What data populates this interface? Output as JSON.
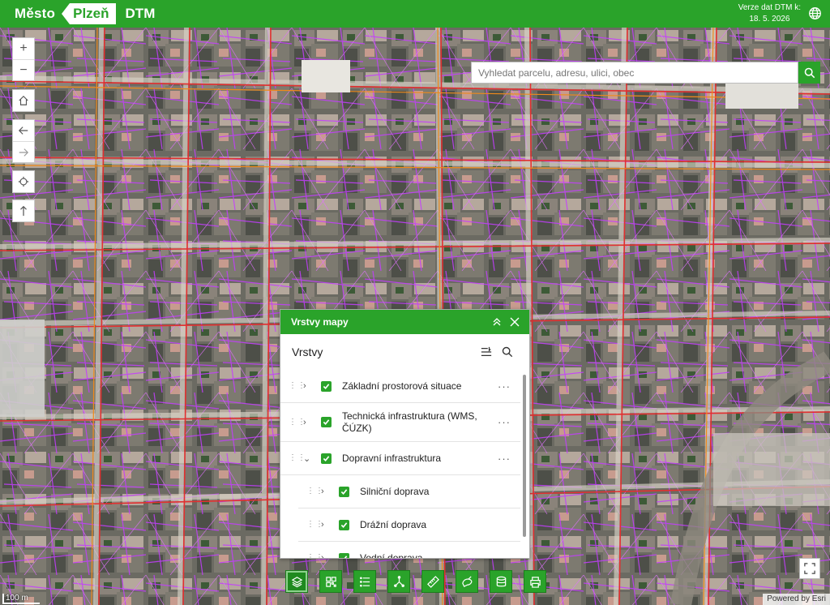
{
  "header": {
    "logo_mesto": "Město",
    "logo_plzen": "Plzeň",
    "app_name": "DTM",
    "version_label": "Verze dat DTM k:",
    "version_date": "18. 5. 2026",
    "brand_color": "#2aa32a"
  },
  "map_controls": {
    "zoom_in": "+",
    "zoom_out": "−"
  },
  "search": {
    "placeholder": "Vyhledat parcelu, adresu, ulici, obec"
  },
  "layers_panel": {
    "title": "Vrstvy mapy",
    "subtitle": "Vrstvy",
    "items": [
      {
        "label": "Základní prostorová situace",
        "expanded": false,
        "checked": true,
        "child": false
      },
      {
        "label": "Technická infrastruktura (WMS, ČÚZK)",
        "expanded": false,
        "checked": true,
        "child": false
      },
      {
        "label": "Dopravní infrastruktura",
        "expanded": true,
        "checked": true,
        "child": false
      },
      {
        "label": "Silniční doprava",
        "expanded": false,
        "checked": true,
        "child": true
      },
      {
        "label": "Drážní doprava",
        "expanded": false,
        "checked": true,
        "child": true
      },
      {
        "label": "Vodní doprava",
        "expanded": false,
        "checked": true,
        "child": true
      }
    ]
  },
  "toolbar": {
    "buttons": [
      "layers-icon",
      "qr-grid-icon",
      "legend-list-icon",
      "measure-icon",
      "ruler-icon",
      "edit-draw-icon",
      "database-icon",
      "print-icon"
    ]
  },
  "scale_label": "100 m",
  "attribution": "Powered by Esri"
}
